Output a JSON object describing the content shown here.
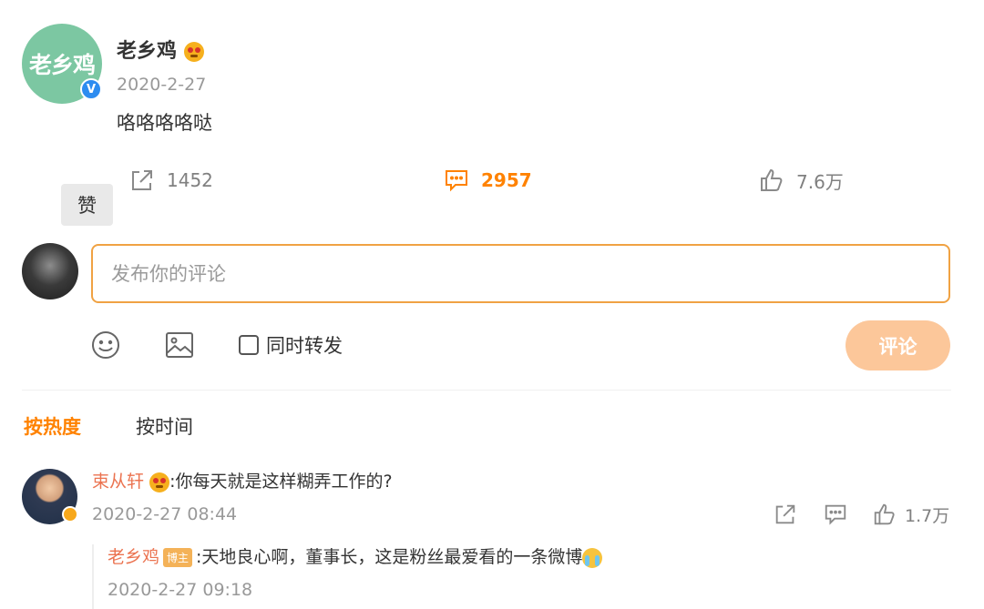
{
  "post": {
    "author": "老乡鸡",
    "avatar_text": "老乡鸡",
    "date": "2020-2-27",
    "content": "咯咯咯咯哒",
    "reposts": "1452",
    "comments": "2957",
    "likes": "7.6万"
  },
  "tooltip": "赞",
  "composer": {
    "placeholder": "发布你的评论",
    "forward_label": "同时转发",
    "submit_label": "评论"
  },
  "sort_tabs": {
    "hot": "按热度",
    "time": "按时间"
  },
  "comment": {
    "user": "束从轩",
    "text": ":你每天就是这样糊弄工作的?",
    "date": "2020-2-27 08:44",
    "likes": "1.7万"
  },
  "reply": {
    "user": "老乡鸡",
    "owner_tag": "博主",
    "text": ":天地良心啊，董事长，这是粉丝最爱看的一条微博",
    "date": "2020-2-27 09:18"
  },
  "colors": {
    "accent": "#ff8200",
    "name_link": "#eb7350",
    "avatar_green": "#7cc7a2",
    "submit_disabled": "#fcc79a"
  },
  "icons": [
    "verified-icon",
    "repost-icon",
    "comment-icon",
    "like-icon",
    "emoji-icon",
    "image-icon"
  ]
}
